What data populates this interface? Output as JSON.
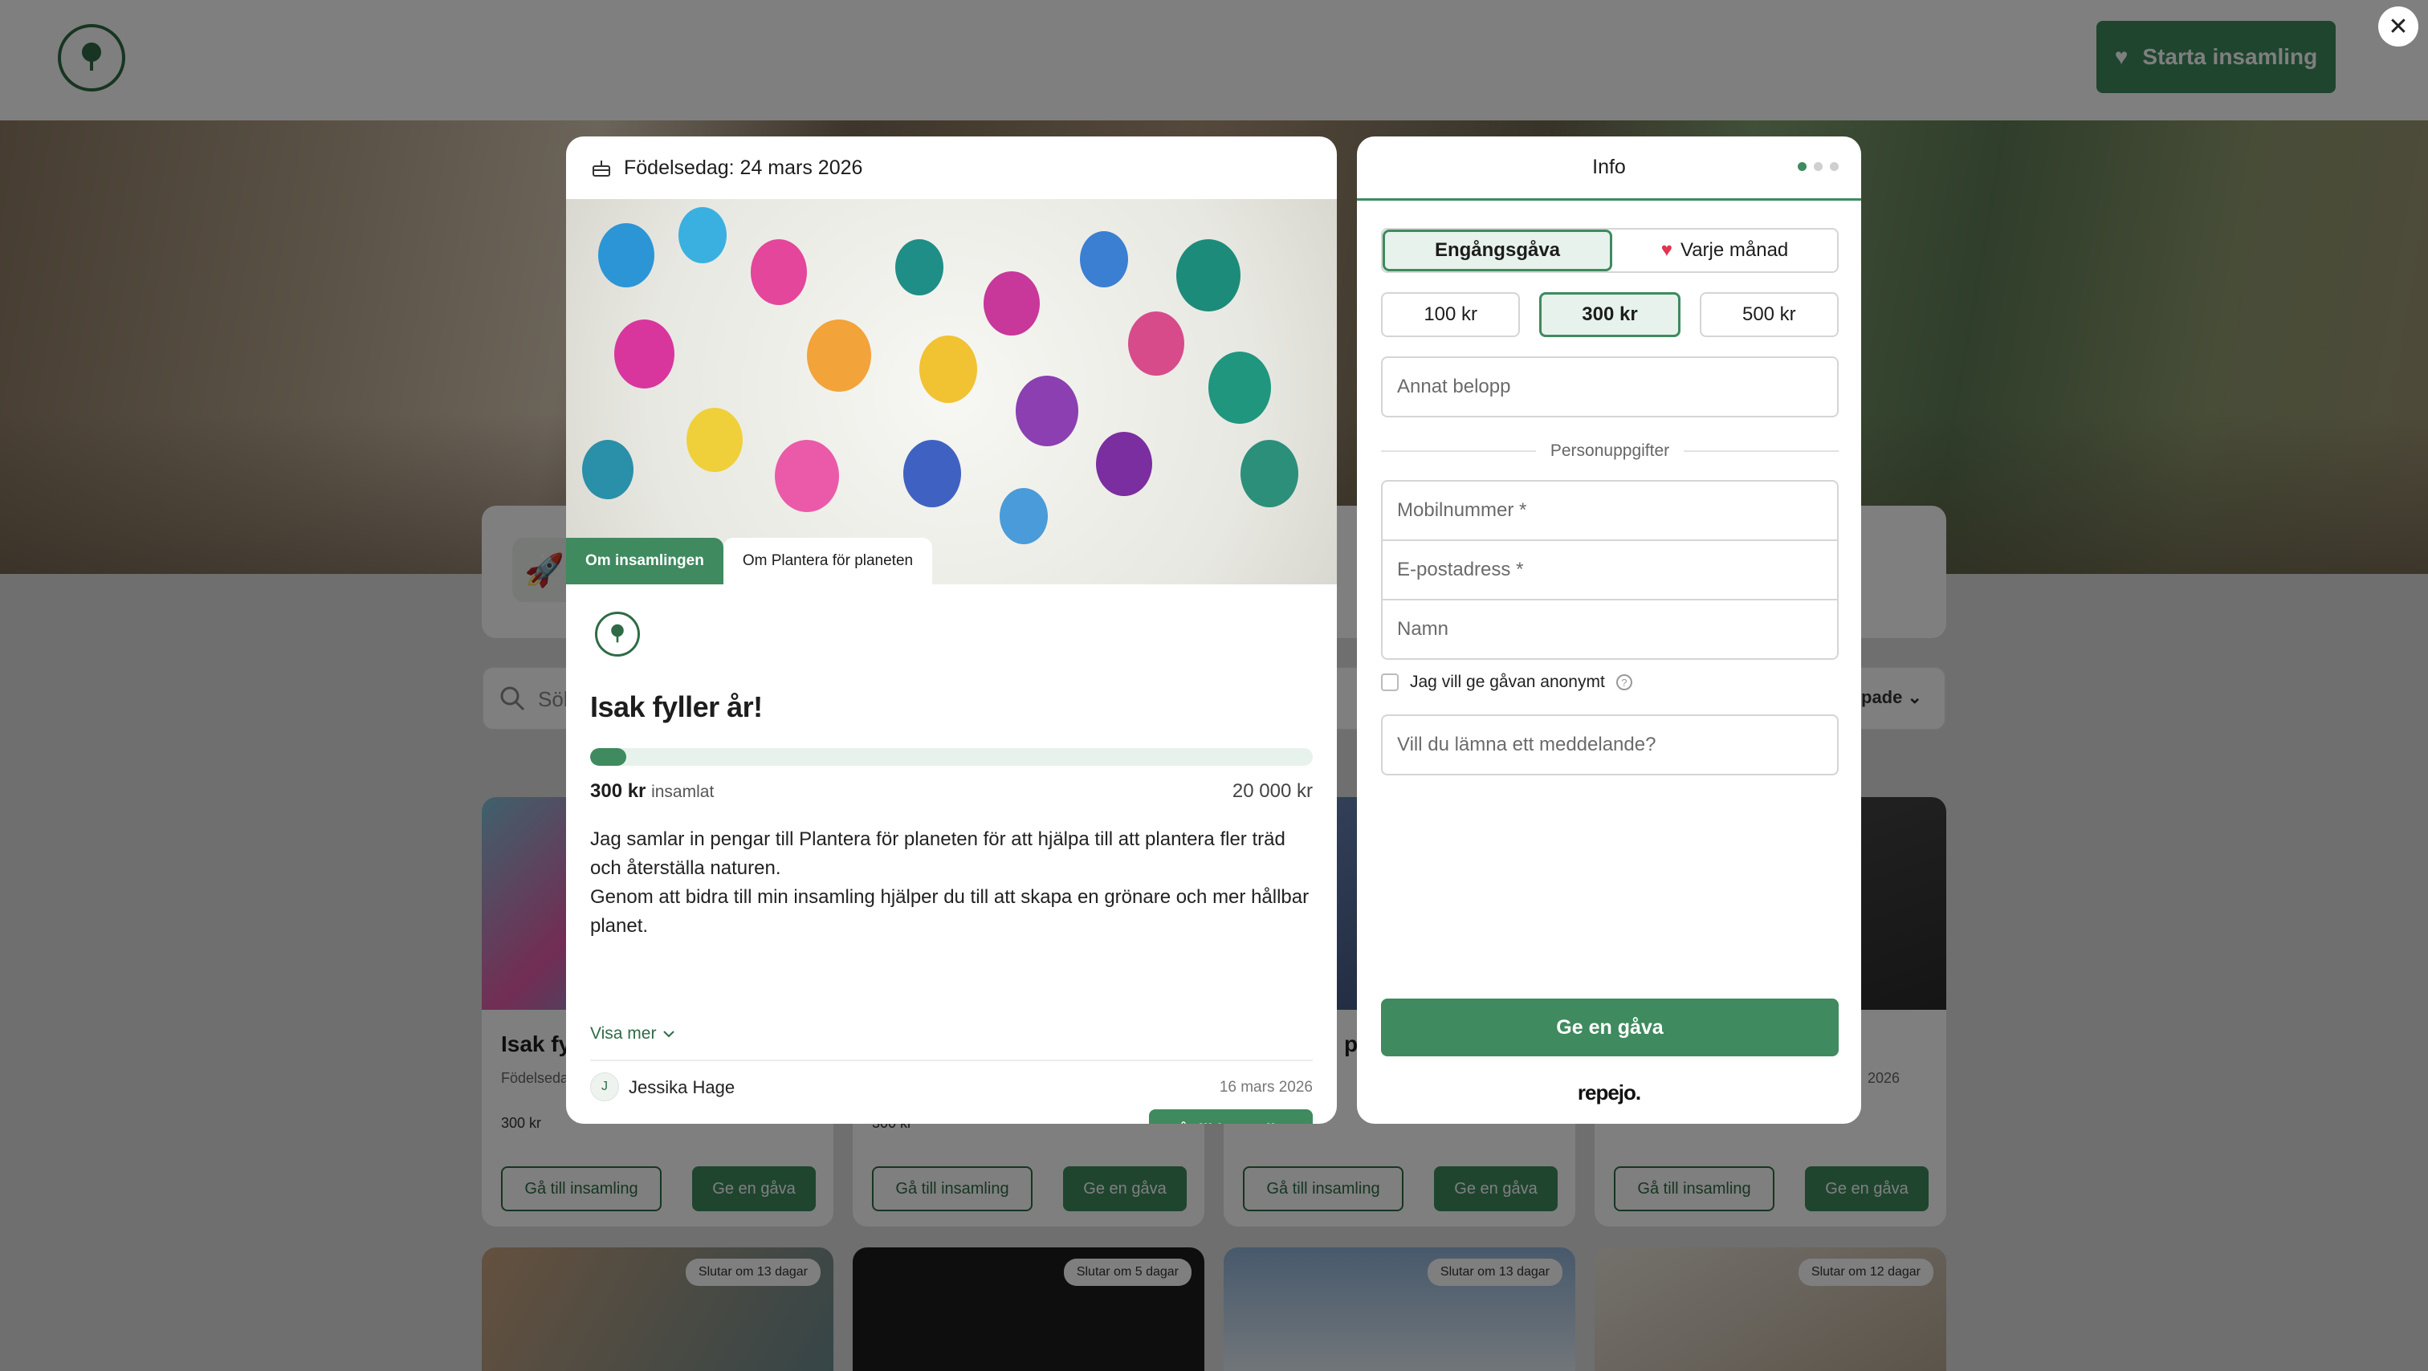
{
  "header": {
    "start_label": "Starta insamling",
    "search_placeholder": "Sök",
    "sort_label": "pade"
  },
  "cards": [
    {
      "title": "Isak fyl",
      "sub": "Födelseda",
      "amount": "300 kr",
      "go": "Gå till insamling",
      "give": "Ge en gåva"
    },
    {
      "title": "",
      "sub": "",
      "amount": "300 kr",
      "go": "Gå till insamling",
      "give": "Ge en gåva"
    },
    {
      "title": "pl",
      "sub": "",
      "amount": "",
      "go": "Gå till insamling",
      "give": "Ge en gåva"
    },
    {
      "title": "",
      "sub": "2026",
      "amount": "",
      "go": "Gå till insamling",
      "give": "Ge en gåva"
    }
  ],
  "badges": [
    "Slutar om 13 dagar",
    "Slutar om 5 dagar",
    "Slutar om 13 dagar",
    "Slutar om 12 dagar"
  ],
  "campaign": {
    "occasion": "Födelsedag: 24 mars 2026",
    "tab_about": "Om insamlingen",
    "tab_org": "Om Plantera för planeten",
    "title": "Isak fyller år!",
    "progress_fraction": 0.015,
    "raised_amount": "300 kr",
    "raised_label": "insamlat",
    "goal": "20 000 kr",
    "desc_1": "Jag samlar in pengar till Plantera för planeten för att hjälpa till att plantera fler träd och återställa naturen.",
    "desc_2": "Genom att bidra till min insamling hjälper du till att skapa en grönare och mer hållbar planet.",
    "show_more": "Visa mer",
    "author_initial": "J",
    "author": "Jessika Hage",
    "date": "16 mars 2026",
    "go_button": "Gå till insamling"
  },
  "donate": {
    "title": "Info",
    "freq_once": "Engångsgåva",
    "freq_monthly": "Varje månad",
    "amounts": [
      "100 kr",
      "300 kr",
      "500 kr"
    ],
    "selected_amount": "300 kr",
    "other_amount_placeholder": "Annat belopp",
    "section_personal": "Personuppgifter",
    "mobile_placeholder": "Mobilnummer *",
    "email_placeholder": "E-postadress *",
    "name_placeholder": "Namn",
    "anonymous_label": "Jag vill ge gåvan anonymt",
    "message_placeholder": "Vill du lämna ett meddelande?",
    "give_button": "Ge en gåva",
    "powered_by": "repejo."
  },
  "colors": {
    "accent": "#3f8a5f",
    "accent_light": "#e8f2ec",
    "heart": "#e2334f"
  }
}
